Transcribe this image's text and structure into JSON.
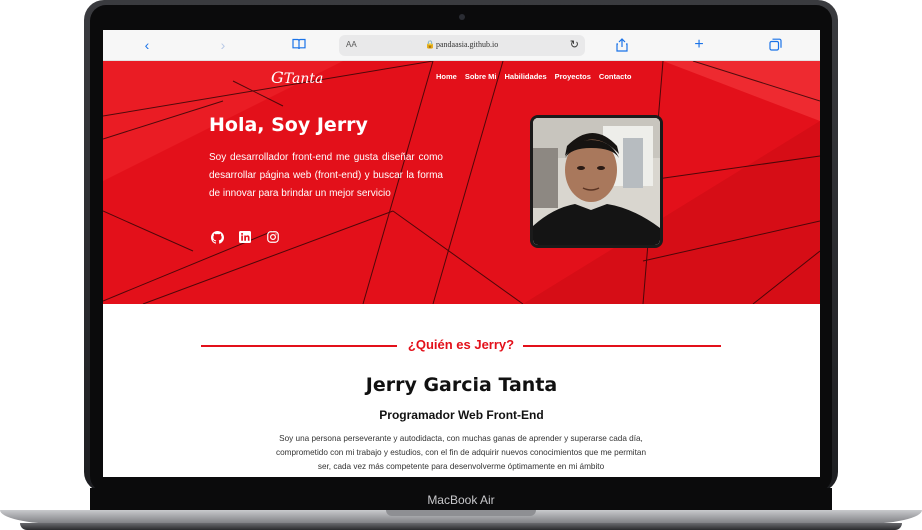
{
  "device": {
    "label": "MacBook Air"
  },
  "browser": {
    "address_aa": "AA",
    "url": "pandaasia.github.io",
    "icons": [
      "back-icon",
      "forward-icon",
      "bookmarks-icon",
      "lock-icon",
      "reload-icon",
      "share-icon",
      "new-tab-icon",
      "tabs-icon"
    ]
  },
  "site": {
    "logo": "Tanta",
    "nav": [
      "Home",
      "Sobre Mi",
      "Habilidades",
      "Proyectos",
      "Contacto"
    ],
    "hero": {
      "greeting": "Hola, Soy Jerry",
      "intro": "Soy desarrollador front-end me gusta diseñar como desarrollar página web (front-end) y buscar la forma de innovar para brindar un mejor servicio",
      "social_icons": [
        "github-icon",
        "linkedin-icon",
        "instagram-icon"
      ]
    },
    "about": {
      "title": "¿Quién es Jerry?",
      "name": "Jerry Garcia Tanta",
      "role": "Programador Web Front-End",
      "bio": "Soy una persona perseverante y autodidacta, con muchas ganas de aprender y superarse cada día, comprometido con mi trabajo y estudios, con el fin de adquirir nuevos conocimientos que me permitan ser, cada vez más competente para desenvolverme óptimamente en mi ámbito"
    }
  },
  "colors": {
    "accent": "#e3101a",
    "browser_blue": "#1a73e8"
  }
}
